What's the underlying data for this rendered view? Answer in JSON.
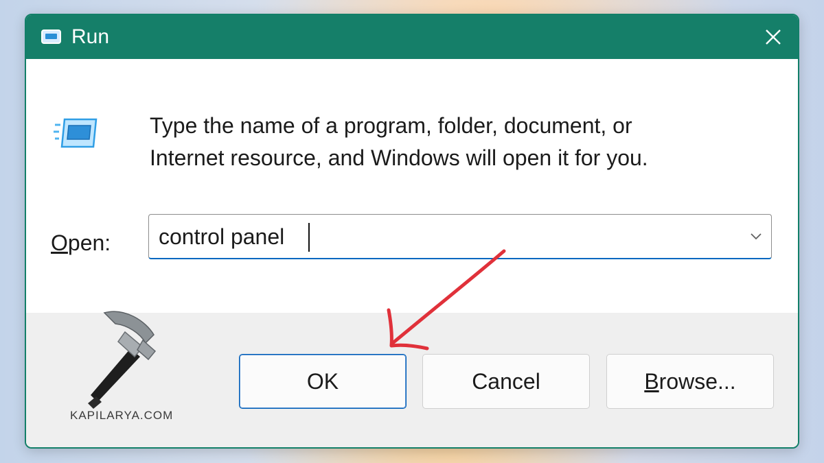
{
  "window": {
    "title": "Run",
    "title_icon": "run-icon",
    "close_icon": "close-icon",
    "titlebar_color": "#157f69"
  },
  "description": {
    "line1": "Type the name of a program, folder, document, or",
    "line2": "Internet resource, and Windows will open it for you."
  },
  "open": {
    "label_mnemonic": "O",
    "label_rest": "pen:",
    "value": "control panel",
    "dropdown_icon": "chevron-down-icon"
  },
  "buttons": {
    "ok": "OK",
    "cancel": "Cancel",
    "browse_mnemonic": "B",
    "browse_rest": "rowse..."
  },
  "watermark": {
    "text": "KAPILARYA.COM",
    "icon": "hammer-icon"
  },
  "annotation": {
    "arrow_color": "#e0313a",
    "points_to": "ok-button"
  }
}
